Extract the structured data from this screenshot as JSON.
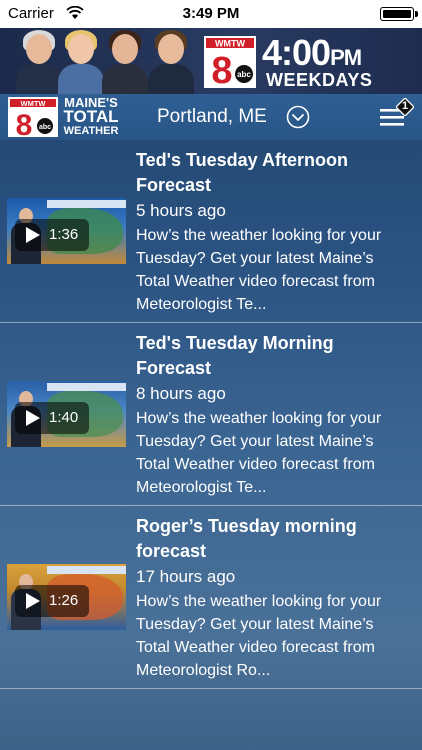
{
  "status_bar": {
    "carrier": "Carrier",
    "time": "3:49 PM"
  },
  "ad_banner": {
    "station": "WMTW",
    "channel": "8",
    "network": "abc",
    "time": "4:00",
    "meridiem": "PM",
    "days": "WEEKDAYS"
  },
  "nav": {
    "logo_station": "WMTW",
    "logo_channel": "8",
    "logo_network": "abc",
    "brand_line1": "MAINE'S",
    "brand_line2": "TOTAL",
    "brand_line3": "WEATHER",
    "location": "Portland, ME",
    "menu_badge": "1"
  },
  "videos": [
    {
      "title": "Ted's Tuesday Afternoon Forecast",
      "time_ago": "5 hours ago",
      "description": "How’s the weather looking for your Tuesday? Get your latest Maine’s Total Weather video forecast from Meteorologist Te...",
      "duration": "1:36"
    },
    {
      "title": "Ted's Tuesday Morning Forecast",
      "time_ago": "8 hours ago",
      "description": "How’s the weather looking for your Tuesday? Get your latest Maine’s Total Weather video forecast from Meteorologist Te...",
      "duration": "1:40"
    },
    {
      "title": "Roger’s Tuesday morning forecast",
      "time_ago": "17 hours ago",
      "description": "How’s the weather looking for your Tuesday? Get your latest Maine’s Total Weather video forecast from Meteorologist Ro...",
      "duration": "1:26"
    }
  ],
  "colors": {
    "accent_red": "#d11f2a",
    "nav_blue": "#2b5a8c",
    "text": "#ffffff"
  }
}
